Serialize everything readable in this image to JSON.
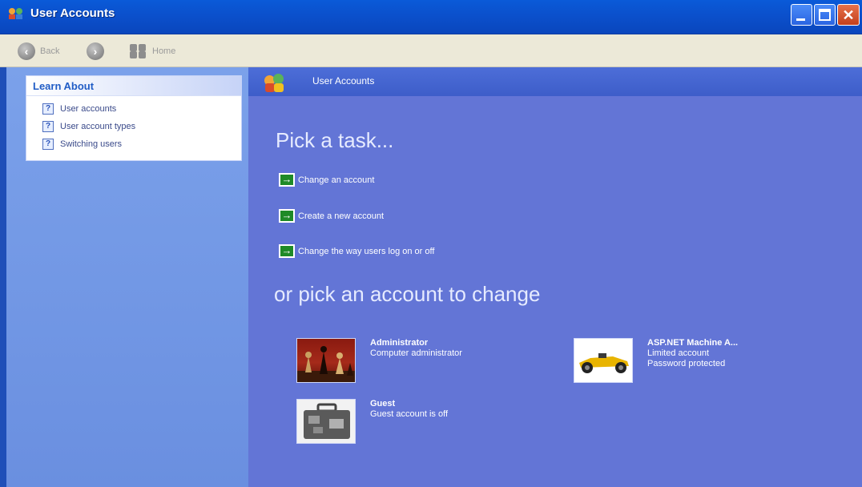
{
  "window": {
    "title": "User Accounts",
    "close_glyph": "✕"
  },
  "toolbar": {
    "back_label": "Back",
    "home_label": "Home"
  },
  "learn_about": {
    "heading": "Learn About",
    "items": [
      {
        "label": "User accounts",
        "icon": "help-icon"
      },
      {
        "label": "User account types",
        "icon": "help-icon"
      },
      {
        "label": "Switching users",
        "icon": "help-icon"
      }
    ]
  },
  "main": {
    "header": "User Accounts",
    "pick_task": "Pick a task...",
    "tasks": [
      "Change an account",
      "Create a new account",
      "Change the way users log on or off"
    ],
    "pick_account": "or pick an account to change",
    "accounts": [
      {
        "name": "Administrator",
        "line1": "Computer administrator",
        "line2": "",
        "picture": "chess-picture"
      },
      {
        "name": "ASP.NET Machine A...",
        "line1": "Limited account",
        "line2": "Password protected",
        "picture": "race-car-picture"
      },
      {
        "name": "Guest",
        "line1": "Guest account is off",
        "line2": "",
        "picture": "briefcase-picture"
      }
    ]
  },
  "colors": {
    "titlebar": "#0b50cc",
    "main_bg": "#6375d6",
    "left_pane": "#7ba1ea",
    "task_arrow": "#1f8a27"
  }
}
